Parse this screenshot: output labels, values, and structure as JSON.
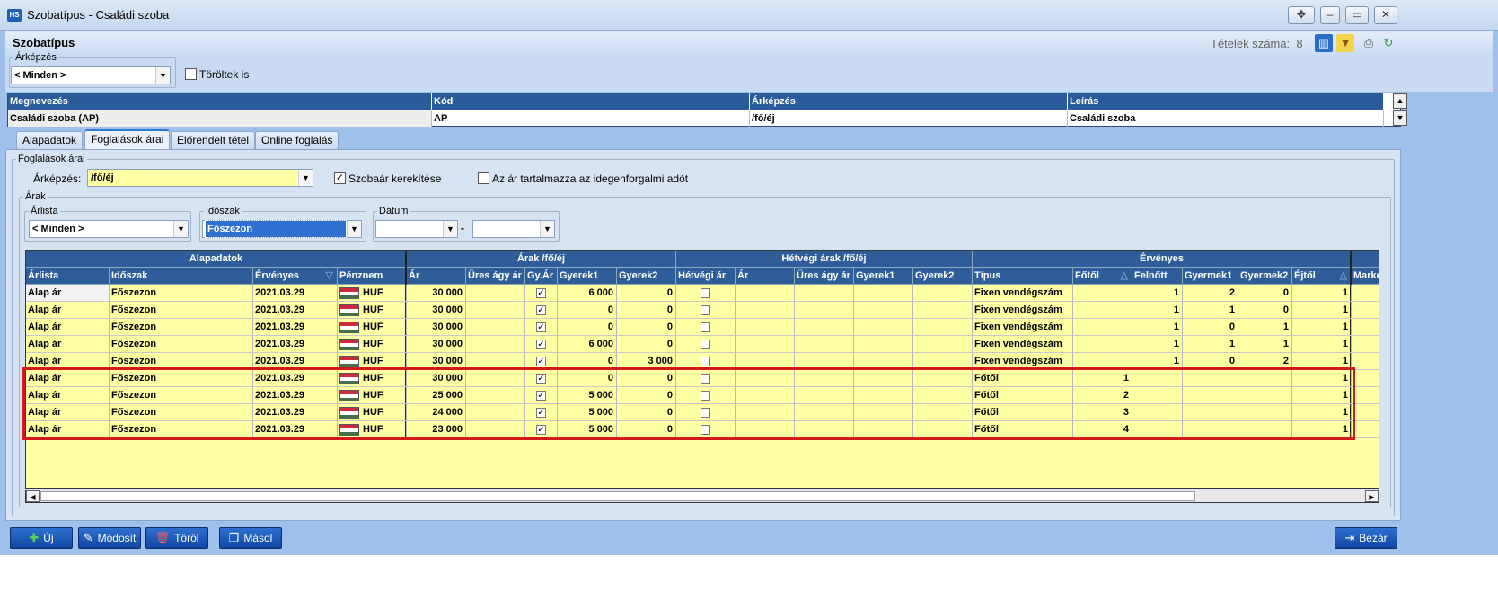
{
  "window": {
    "title": "Szobatípus - Családi szoba"
  },
  "header": {
    "title": "Szobatípus",
    "count_label": "Tételek száma:",
    "count_value": "8"
  },
  "filter": {
    "arkepzes_legend": "Árképzés",
    "arkepzes_value": "< Minden >",
    "toroltek_label": "Töröltek is"
  },
  "top_table": {
    "columns": [
      "Megnevezés",
      "Kód",
      "Árképzés",
      "Leírás"
    ],
    "row": [
      "Családi szoba (AP)",
      "AP",
      "/fő/éj",
      "Családi szoba"
    ]
  },
  "tabs": [
    "Alapadatok",
    "Foglalások árai",
    "Előrendelt tétel",
    "Online foglalás"
  ],
  "foglalasok": {
    "legend": "Foglalások árai",
    "arkepzes_label": "Árképzés:",
    "arkepzes_value": "/fő/éj",
    "szobaar_label": "Szobaár kerekítése",
    "idegenforg_label": "Az ár tartalmazza az idegenforgalmi adót",
    "arak_legend": "Árak",
    "arlista_legend": "Árlista",
    "arlista_value": "< Minden >",
    "idoszak_legend": "Időszak",
    "idoszak_value": "Főszezon",
    "datum_legend": "Dátum",
    "datum_sep": "-"
  },
  "grid": {
    "groups": [
      "Alapadatok",
      "Árak /fő/éj",
      "Hétvégi árak /fő/éj",
      "Érvényes"
    ],
    "columns": [
      "Árlista",
      "Időszak",
      "Érvényes",
      "Pénznem",
      "Ár",
      "Üres ágy ár",
      "Gy.Ár",
      "Gyerek1",
      "Gyerek2",
      "Hétvégi ár",
      "Ár",
      "Üres ágy ár",
      "Gyerek1",
      "Gyerek2",
      "Típus",
      "Főtől",
      "Felnőtt",
      "Gyermek1",
      "Gyermek2",
      "Éjtől",
      "Marke"
    ],
    "rows": [
      [
        "Alap ár",
        "Főszezon",
        "2021.03.29",
        "HUF",
        "30 000",
        "",
        true,
        "6 000",
        "0",
        false,
        "",
        "",
        "",
        "",
        "Fixen vendégszám",
        "",
        "1",
        "2",
        "0",
        "1"
      ],
      [
        "Alap ár",
        "Főszezon",
        "2021.03.29",
        "HUF",
        "30 000",
        "",
        true,
        "0",
        "0",
        false,
        "",
        "",
        "",
        "",
        "Fixen vendégszám",
        "",
        "1",
        "1",
        "0",
        "1"
      ],
      [
        "Alap ár",
        "Főszezon",
        "2021.03.29",
        "HUF",
        "30 000",
        "",
        true,
        "0",
        "0",
        false,
        "",
        "",
        "",
        "",
        "Fixen vendégszám",
        "",
        "1",
        "0",
        "1",
        "1"
      ],
      [
        "Alap ár",
        "Főszezon",
        "2021.03.29",
        "HUF",
        "30 000",
        "",
        true,
        "6 000",
        "0",
        false,
        "",
        "",
        "",
        "",
        "Fixen vendégszám",
        "",
        "1",
        "1",
        "1",
        "1"
      ],
      [
        "Alap ár",
        "Főszezon",
        "2021.03.29",
        "HUF",
        "30 000",
        "",
        true,
        "0",
        "3 000",
        false,
        "",
        "",
        "",
        "",
        "Fixen vendégszám",
        "",
        "1",
        "0",
        "2",
        "1"
      ],
      [
        "Alap ár",
        "Főszezon",
        "2021.03.29",
        "HUF",
        "30 000",
        "",
        true,
        "0",
        "0",
        false,
        "",
        "",
        "",
        "",
        "Főtől",
        "1",
        "",
        "",
        "",
        "1"
      ],
      [
        "Alap ár",
        "Főszezon",
        "2021.03.29",
        "HUF",
        "25 000",
        "",
        true,
        "5 000",
        "0",
        false,
        "",
        "",
        "",
        "",
        "Főtől",
        "2",
        "",
        "",
        "",
        "1"
      ],
      [
        "Alap ár",
        "Főszezon",
        "2021.03.29",
        "HUF",
        "24 000",
        "",
        true,
        "5 000",
        "0",
        false,
        "",
        "",
        "",
        "",
        "Főtől",
        "3",
        "",
        "",
        "",
        "1"
      ],
      [
        "Alap ár",
        "Főszezon",
        "2021.03.29",
        "HUF",
        "23 000",
        "",
        true,
        "5 000",
        "0",
        false,
        "",
        "",
        "",
        "",
        "Főtől",
        "4",
        "",
        "",
        "",
        "1"
      ]
    ]
  },
  "buttons": {
    "uj": "Új",
    "modosit": "Módosít",
    "torol": "Töröl",
    "masol": "Másol",
    "bezar": "Bezár"
  },
  "colors": {
    "header_blue": "#2f5d99",
    "grid_bg": "#ffffa3",
    "highlight": "#d11a1a",
    "button_blue": "#1a57b8"
  }
}
